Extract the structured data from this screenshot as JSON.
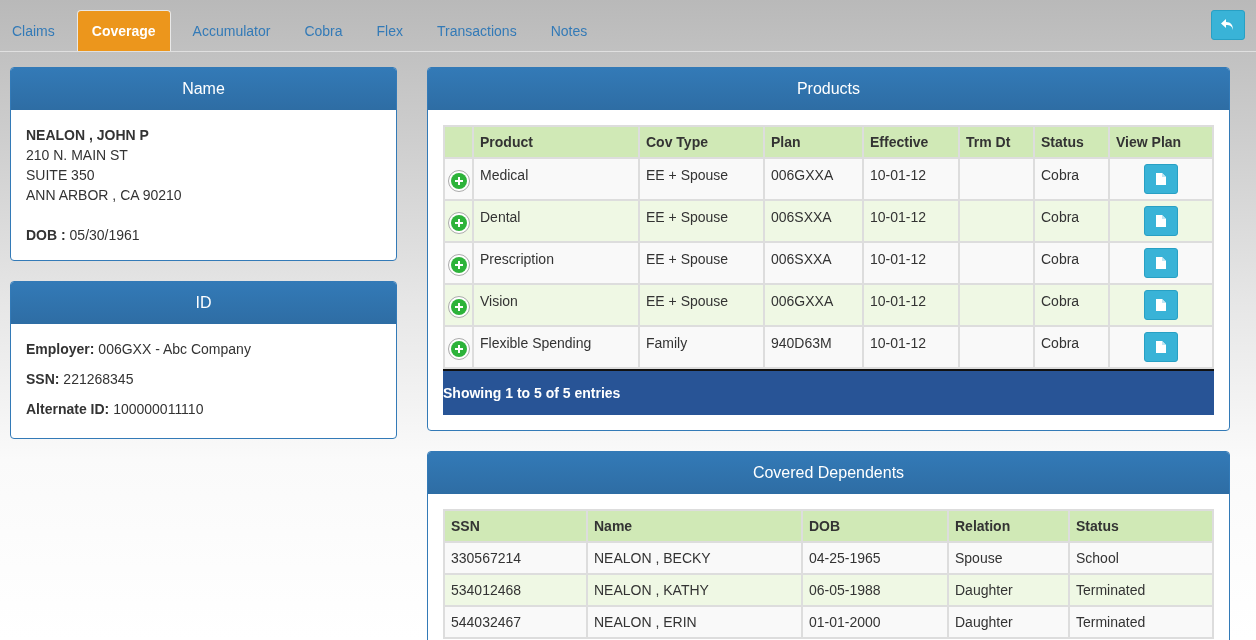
{
  "tabs": [
    {
      "label": "Claims",
      "selected": false
    },
    {
      "label": "Coverage",
      "selected": true
    },
    {
      "label": "Accumulator",
      "selected": false
    },
    {
      "label": "Cobra",
      "selected": false
    },
    {
      "label": "Flex",
      "selected": false
    },
    {
      "label": "Transactions",
      "selected": false
    },
    {
      "label": "Notes",
      "selected": false
    }
  ],
  "name_panel": {
    "title": "Name",
    "name": "NEALON , JOHN P",
    "address_lines": [
      "210 N. MAIN ST",
      "SUITE 350",
      "ANN ARBOR , CA 90210"
    ],
    "dob_label": "DOB :",
    "dob": "05/30/1961"
  },
  "id_panel": {
    "title": "ID",
    "fields": [
      {
        "label": "Employer:",
        "value": "006GXX - Abc Company"
      },
      {
        "label": "SSN:",
        "value": "221268345"
      },
      {
        "label": "Alternate ID:",
        "value": "100000011110"
      }
    ]
  },
  "products": {
    "title": "Products",
    "columns": [
      "Product",
      "Cov Type",
      "Plan",
      "Effective",
      "Trm Dt",
      "Status",
      "View Plan"
    ],
    "rows": [
      {
        "product": "Medical",
        "cov_type": "EE + Spouse",
        "plan": "006GXXA",
        "effective": "10-01-12",
        "status": "Cobra"
      },
      {
        "product": "Dental",
        "cov_type": "EE + Spouse",
        "plan": "006SXXA",
        "effective": "10-01-12",
        "status": "Cobra"
      },
      {
        "product": "Prescription",
        "cov_type": "EE + Spouse",
        "plan": "006SXXA",
        "effective": "10-01-12",
        "status": "Cobra"
      },
      {
        "product": "Vision",
        "cov_type": "EE + Spouse",
        "plan": "006GXXA",
        "effective": "10-01-12",
        "status": "Cobra"
      },
      {
        "product": "Flexible Spending",
        "cov_type": "Family",
        "plan": "940D63M",
        "effective": "10-01-12",
        "status": "Cobra"
      }
    ],
    "footer": "Showing 1 to 5 of 5 entries"
  },
  "dependents": {
    "title": "Covered Dependents",
    "columns": [
      "SSN",
      "Name",
      "DOB",
      "Relation",
      "Status"
    ],
    "rows": [
      {
        "ssn": "330567214",
        "name": "NEALON , BECKY",
        "dob": "04-25-1965",
        "relation": "Spouse",
        "status": "School"
      },
      {
        "ssn": "534012468",
        "name": "NEALON , KATHY",
        "dob": "06-05-1988",
        "relation": "Daughter",
        "status": "Terminated"
      },
      {
        "ssn": "544032467",
        "name": "NEALON , ERIN",
        "dob": "01-01-2000",
        "relation": "Daughter",
        "status": "Terminated"
      }
    ]
  }
}
